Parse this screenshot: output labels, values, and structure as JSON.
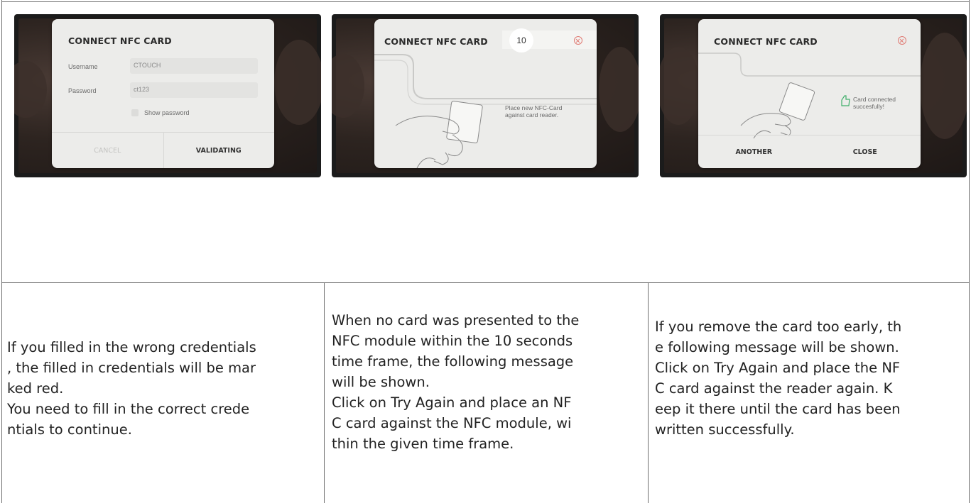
{
  "screens": [
    {
      "title": "CONNECT NFC CARD",
      "username_label": "Username",
      "username_value": "CTOUCH",
      "password_label": "Password",
      "password_value": "ct123",
      "show_password_label": "Show password",
      "cancel_label": "CANCEL",
      "validating_label": "VALIDATING"
    },
    {
      "title": "CONNECT NFC CARD",
      "counter": "10",
      "instruction": "Place new NFC-Card\nagainst card reader."
    },
    {
      "title": "CONNECT NFC CARD",
      "status": "Card connected\nsuccesfully!",
      "another_label": "ANOTHER",
      "close_label": "CLOSE"
    }
  ],
  "descriptions": [
    "If you filled in the wrong credentials\n, the filled in  credentials will be mar\nked red.\nYou need to fill in the  correct crede\nntials to continue.",
    "When no card was presented to the\nNFC module  within the 10 seconds\ntime frame, the following  message\nwill be shown.\nClick on Try Again and place  an NF\nC card against  the NFC module, wi\nthin the given time frame.",
    "If you remove the card too early, th\ne following  message will be shown.\nClick on Try Again and place the NF\nC card against  the reader again. K\neep it there until the card has been\nwritten successfully."
  ]
}
